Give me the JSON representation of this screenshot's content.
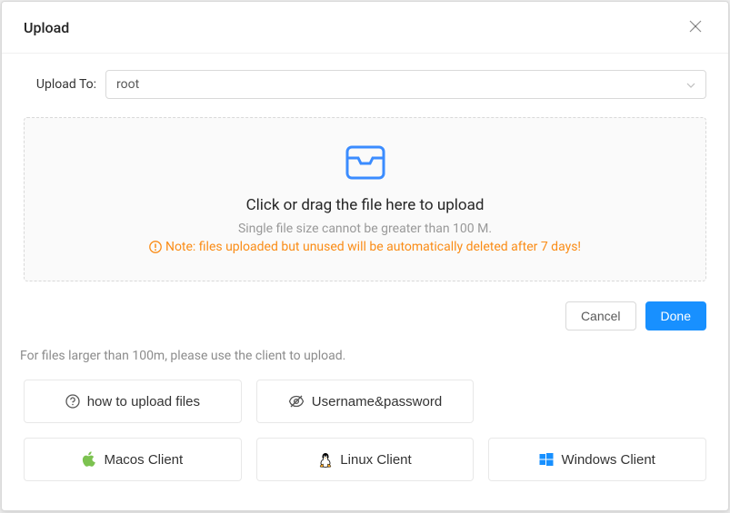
{
  "modal": {
    "title": "Upload",
    "close_label": "×"
  },
  "form": {
    "upload_to_label": "Upload To:",
    "upload_to_value": "root"
  },
  "dropzone": {
    "title": "Click or drag the file here to upload",
    "subtitle": "Single file size cannot be greater than 100 M.",
    "note": "Note: files uploaded but unused will be automatically deleted after 7 days!"
  },
  "actions": {
    "cancel": "Cancel",
    "done": "Done"
  },
  "helper": "For files larger than 100m, please use the client to upload.",
  "options": {
    "how_to": "how to upload files",
    "credentials": "Username&password",
    "macos": "Macos Client",
    "linux": "Linux Client",
    "windows": "Windows Client"
  }
}
